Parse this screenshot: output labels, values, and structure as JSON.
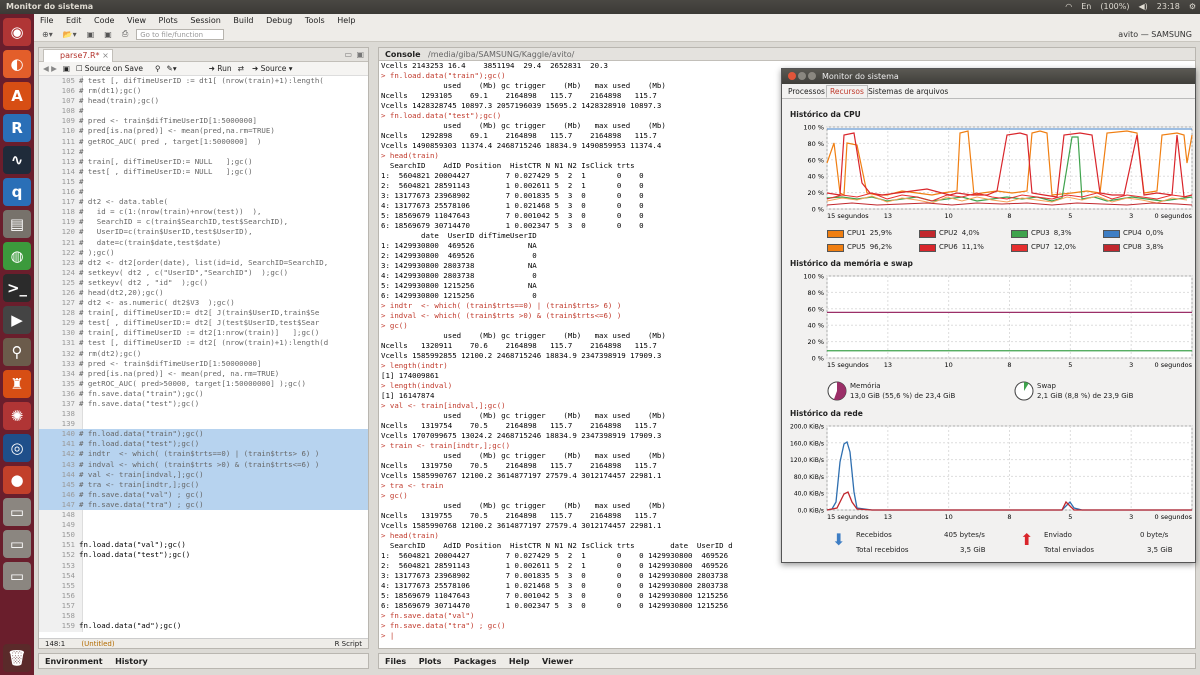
{
  "topbar": {
    "title": "Monitor do sistema",
    "lang": "En",
    "battery": "(100%)",
    "volume": "◀)",
    "time": "23:18"
  },
  "menu": [
    "File",
    "Edit",
    "Code",
    "View",
    "Plots",
    "Session",
    "Build",
    "Debug",
    "Tools",
    "Help"
  ],
  "toolbar": {
    "goto_placeholder": "Go to file/function",
    "project": "avito — SAMSUNG"
  },
  "editor": {
    "tab": "parse7.R*",
    "source_on_save": "Source on Save",
    "run": "Run",
    "source": "Source",
    "status_pos": "148:1",
    "status_scope": "(Untitled)",
    "status_type": "R Script"
  },
  "code_lines": [
    {
      "n": "105",
      "t": "# test [, difTimeUserID := dt1[ (nrow(train)+1):length(",
      "s": false,
      "c": false
    },
    {
      "n": "106",
      "t": "# rm(dt1);gc()",
      "s": false,
      "c": false
    },
    {
      "n": "107",
      "t": "# head(train);gc()",
      "s": false,
      "c": false
    },
    {
      "n": "108",
      "t": "#",
      "s": false,
      "c": false
    },
    {
      "n": "109",
      "t": "# pred <- train$difTimeUserID[1:5000000]",
      "s": false,
      "c": false
    },
    {
      "n": "110",
      "t": "# pred[is.na(pred)] <- mean(pred,na.rm=TRUE)",
      "s": false,
      "c": false
    },
    {
      "n": "111",
      "t": "# getROC_AUC( pred , target[1:5000000]  )",
      "s": false,
      "c": false
    },
    {
      "n": "112",
      "t": "#",
      "s": false,
      "c": false
    },
    {
      "n": "113",
      "t": "# train[, difTimeUserID:= NULL   ];gc()",
      "s": false,
      "c": false
    },
    {
      "n": "114",
      "t": "# test[ , difTimeUserID:= NULL   ];gc()",
      "s": false,
      "c": false
    },
    {
      "n": "115",
      "t": "#",
      "s": false,
      "c": false
    },
    {
      "n": "116",
      "t": "#",
      "s": false,
      "c": false
    },
    {
      "n": "117",
      "t": "# dt2 <- data.table(",
      "s": false,
      "c": false
    },
    {
      "n": "118",
      "t": "#   id = c(1:(nrow(train)+nrow(test))  ),",
      "s": false,
      "c": false
    },
    {
      "n": "119",
      "t": "#   SearchID = c(train$SearchID,test$SearchID),",
      "s": false,
      "c": false
    },
    {
      "n": "120",
      "t": "#   UserID=c(train$UserID,test$UserID),",
      "s": false,
      "c": false
    },
    {
      "n": "121",
      "t": "#   date=c(train$date,test$date)",
      "s": false,
      "c": false
    },
    {
      "n": "122",
      "t": "# );gc()",
      "s": false,
      "c": false
    },
    {
      "n": "123",
      "t": "# dt2 <- dt2[order(date), list(id=id, SearchID=SearchID,",
      "s": false,
      "c": false
    },
    {
      "n": "124",
      "t": "# setkeyv( dt2 , c(\"UserID\",\"SearchID\")  );gc()",
      "s": false,
      "c": false
    },
    {
      "n": "125",
      "t": "# setkeyv( dt2 , \"id\"  );gc()",
      "s": false,
      "c": false
    },
    {
      "n": "126",
      "t": "# head(dt2,20);gc()",
      "s": false,
      "c": false
    },
    {
      "n": "127",
      "t": "# dt2 <- as.numeric( dt2$V3  );gc()",
      "s": false,
      "c": false
    },
    {
      "n": "128",
      "t": "# train[, difTimeUserID:= dt2[ J(train$UserID,train$Se",
      "s": false,
      "c": false
    },
    {
      "n": "129",
      "t": "# test[ , difTimeUserID:= dt2[ J(test$UserID,test$Sear",
      "s": false,
      "c": false
    },
    {
      "n": "130",
      "t": "# train[, difTimeUserID := dt2[1:nrow(train)]   ];gc()",
      "s": false,
      "c": false
    },
    {
      "n": "131",
      "t": "# test [, difTimeUserID := dt2[ (nrow(train)+1):length(d",
      "s": false,
      "c": false
    },
    {
      "n": "132",
      "t": "# rm(dt2);gc()",
      "s": false,
      "c": false
    },
    {
      "n": "133",
      "t": "# pred <- train$difTimeUserID[1:50000000]",
      "s": false,
      "c": false
    },
    {
      "n": "134",
      "t": "# pred[is.na(pred)] <- mean(pred, na.rm=TRUE)",
      "s": false,
      "c": false
    },
    {
      "n": "135",
      "t": "# getROC_AUC( pred>50000, target[1:50000000] );gc()",
      "s": false,
      "c": false
    },
    {
      "n": "136",
      "t": "# fn.save.data(\"train\");gc()",
      "s": false,
      "c": false
    },
    {
      "n": "137",
      "t": "# fn.save.data(\"test\");gc()",
      "s": false,
      "c": false
    },
    {
      "n": "138",
      "t": "",
      "s": false,
      "c": false
    },
    {
      "n": "139",
      "t": "",
      "s": false,
      "c": false
    },
    {
      "n": "140",
      "t": "# fn.load.data(\"train\");gc()",
      "s": true,
      "c": false
    },
    {
      "n": "141",
      "t": "# fn.load.data(\"test\");gc()",
      "s": true,
      "c": false
    },
    {
      "n": "142",
      "t": "# indtr  <- which( (train$trts==0) | (train$trts> 6) )",
      "s": true,
      "c": false
    },
    {
      "n": "143",
      "t": "# indval <- which( (train$trts >0) & (train$trts<=6) )",
      "s": true,
      "c": false
    },
    {
      "n": "144",
      "t": "# val <- train[indval,];gc()",
      "s": true,
      "c": false
    },
    {
      "n": "145",
      "t": "# tra <- train[indtr,];gc()",
      "s": true,
      "c": false
    },
    {
      "n": "146",
      "t": "# fn.save.data(\"val\") ; gc()",
      "s": true,
      "c": false
    },
    {
      "n": "147",
      "t": "# fn.save.data(\"tra\") ; gc()",
      "s": true,
      "c": false
    },
    {
      "n": "148",
      "t": "",
      "s": false,
      "c": false
    },
    {
      "n": "149",
      "t": "",
      "s": false,
      "c": false
    },
    {
      "n": "150",
      "t": "",
      "s": false,
      "c": false
    },
    {
      "n": "151",
      "t": "fn.load.data(\"val\");gc()",
      "s": false,
      "c": true
    },
    {
      "n": "152",
      "t": "fn.load.data(\"test\");gc()",
      "s": false,
      "c": true
    },
    {
      "n": "153",
      "t": "",
      "s": false,
      "c": false
    },
    {
      "n": "154",
      "t": "",
      "s": false,
      "c": false
    },
    {
      "n": "155",
      "t": "",
      "s": false,
      "c": false
    },
    {
      "n": "156",
      "t": "",
      "s": false,
      "c": false
    },
    {
      "n": "157",
      "t": "",
      "s": false,
      "c": false
    },
    {
      "n": "158",
      "t": "",
      "s": false,
      "c": false
    },
    {
      "n": "159",
      "t": "fn.load.data(\"ad\");gc()",
      "s": false,
      "c": true
    },
    {
      "n": "160",
      "t": "ad <- data.table(ad)",
      "s": false,
      "c": true
    }
  ],
  "console": {
    "title": "Console",
    "path": "/media/giba/SAMSUNG/Kaggle/avito/"
  },
  "console_lines": [
    {
      "t": "Vcells 2143253 16.4    3851194  29.4  2652831  20.3",
      "c": false
    },
    {
      "t": "> fn.load.data(\"train\");gc()",
      "c": true
    },
    {
      "t": "              used    (Mb) gc trigger    (Mb)   max used    (Mb)",
      "c": false
    },
    {
      "t": "Ncells   1293105    69.1    2164898   115.7    2164898   115.7",
      "c": false
    },
    {
      "t": "Vcells 1428328745 10897.3 2057196039 15695.2 1428328910 10897.3",
      "c": false
    },
    {
      "t": "> fn.load.data(\"test\");gc()",
      "c": true
    },
    {
      "t": "              used    (Mb) gc trigger    (Mb)   max used    (Mb)",
      "c": false
    },
    {
      "t": "Ncells   1292898    69.1    2164898   115.7    2164898   115.7",
      "c": false
    },
    {
      "t": "Vcells 1490859303 11374.4 2468715246 18834.9 1490859953 11374.4",
      "c": false
    },
    {
      "t": "> head(train)",
      "c": true
    },
    {
      "t": "  SearchID    AdID Position  HistCTR N N1 N2 IsClick trts",
      "c": false
    },
    {
      "t": "1:  5604821 20004427        7 0.027429 5  2  1       0    0",
      "c": false
    },
    {
      "t": "2:  5604821 28591143        1 0.002611 5  2  1       0    0",
      "c": false
    },
    {
      "t": "3: 13177673 23968902        7 0.001835 5  3  0       0    0",
      "c": false
    },
    {
      "t": "4: 13177673 25578106        1 0.021468 5  3  0       0    0",
      "c": false
    },
    {
      "t": "5: 18569679 11047643        7 0.001042 5  3  0       0    0",
      "c": false
    },
    {
      "t": "6: 18569679 30714470        1 0.002347 5  3  0       0    0",
      "c": false
    },
    {
      "t": "         date  UserID difTimeUserID",
      "c": false
    },
    {
      "t": "1: 1429930800  469526            NA",
      "c": false
    },
    {
      "t": "2: 1429930800  469526             0",
      "c": false
    },
    {
      "t": "3: 1429930800 2803738            NA",
      "c": false
    },
    {
      "t": "4: 1429930800 2803738             0",
      "c": false
    },
    {
      "t": "5: 1429930800 1215256            NA",
      "c": false
    },
    {
      "t": "6: 1429930800 1215256             0",
      "c": false
    },
    {
      "t": "> indtr  <- which( (train$trts==0) | (train$trts> 6) )",
      "c": true
    },
    {
      "t": "> indval <- which( (train$trts >0) & (train$trts<=6) )",
      "c": true
    },
    {
      "t": "> gc()",
      "c": true
    },
    {
      "t": "              used    (Mb) gc trigger    (Mb)   max used    (Mb)",
      "c": false
    },
    {
      "t": "Ncells   1320911    70.6    2164898   115.7    2164898   115.7",
      "c": false
    },
    {
      "t": "Vcells 1585992855 12100.2 2468715246 18834.9 2347398919 17909.3",
      "c": false
    },
    {
      "t": "> length(indtr)",
      "c": true
    },
    {
      "t": "[1] 174009861",
      "c": false
    },
    {
      "t": "> length(indval)",
      "c": true
    },
    {
      "t": "[1] 16147874",
      "c": false
    },
    {
      "t": "> val <- train[indval,];gc()",
      "c": true
    },
    {
      "t": "              used    (Mb) gc trigger    (Mb)   max used    (Mb)",
      "c": false
    },
    {
      "t": "Ncells   1319754    70.5    2164898   115.7    2164898   115.7",
      "c": false
    },
    {
      "t": "Vcells 1707099675 13024.2 2468715246 18834.9 2347398919 17909.3",
      "c": false
    },
    {
      "t": "> train <- train[indtr,];gc()",
      "c": true
    },
    {
      "t": "              used    (Mb) gc trigger    (Mb)   max used    (Mb)",
      "c": false
    },
    {
      "t": "Ncells   1319750    70.5    2164898   115.7    2164898   115.7",
      "c": false
    },
    {
      "t": "Vcells 1585990767 12100.2 3614877197 27579.4 3012174457 22981.1",
      "c": false
    },
    {
      "t": "> tra <- train",
      "c": true
    },
    {
      "t": "> gc()",
      "c": true
    },
    {
      "t": "              used    (Mb) gc trigger    (Mb)   max used    (Mb)",
      "c": false
    },
    {
      "t": "Ncells   1319755    70.5    2164898   115.7    2164898   115.7",
      "c": false
    },
    {
      "t": "Vcells 1585990768 12100.2 3614877197 27579.4 3012174457 22981.1",
      "c": false
    },
    {
      "t": "> head(train)",
      "c": true
    },
    {
      "t": "  SearchID    AdID Position  HistCTR N N1 N2 IsClick trts        date  UserID d",
      "c": false
    },
    {
      "t": "1:  5604821 20004427        7 0.027429 5  2  1       0    0 1429930800  469526",
      "c": false
    },
    {
      "t": "2:  5604821 28591143        1 0.002611 5  2  1       0    0 1429930800  469526",
      "c": false
    },
    {
      "t": "3: 13177673 23968902        7 0.001835 5  3  0       0    0 1429930800 2803738",
      "c": false
    },
    {
      "t": "4: 13177673 25578106        1 0.021468 5  3  0       0    0 1429930800 2803738",
      "c": false
    },
    {
      "t": "5: 18569679 11047643        7 0.001042 5  3  0       0    0 1429930800 1215256",
      "c": false
    },
    {
      "t": "6: 18569679 30714470        1 0.002347 5  3  0       0    0 1429930800 1215256",
      "c": false
    },
    {
      "t": "> fn.save.data(\"val\")",
      "c": true
    },
    {
      "t": "> fn.save.data(\"tra\") ; gc()",
      "c": true
    },
    {
      "t": "> |",
      "c": true
    }
  ],
  "bottom_left_tabs": [
    "Environment",
    "History"
  ],
  "bottom_right_tabs": [
    "Files",
    "Plots",
    "Packages",
    "Help",
    "Viewer"
  ],
  "monitor": {
    "title": "Monitor do sistema",
    "tabs": [
      "Processos",
      "Recursos",
      "Sistemas de arquivos"
    ],
    "cpu_title": "Histórico da CPU",
    "mem_title": "Histórico da memória e swap",
    "net_title": "Histórico da rede",
    "cpu_y": [
      "100 %",
      "80 %",
      "60 %",
      "40 %",
      "20 %",
      "0 %"
    ],
    "mem_y": [
      "100 %",
      "80 %",
      "60 %",
      "40 %",
      "20 %",
      "0 %"
    ],
    "net_y": [
      "200,0 KiB/s",
      "160,0 KiB/s",
      "120,0 KiB/s",
      "80,0 KiB/s",
      "40,0 KiB/s",
      "0,0 KiB/s"
    ],
    "x_ticks": [
      "15 segundos",
      "13",
      "10",
      "8",
      "5",
      "3",
      "0 segundos"
    ],
    "cpus": [
      {
        "name": "CPU1",
        "val": "25,9%",
        "color": "#f07f12"
      },
      {
        "name": "CPU2",
        "val": "4,0%",
        "color": "#c1272d"
      },
      {
        "name": "CPU3",
        "val": "8,3%",
        "color": "#3fa34d"
      },
      {
        "name": "CPU4",
        "val": "0,0%",
        "color": "#3e7ec4"
      },
      {
        "name": "CPU5",
        "val": "96,2%",
        "color": "#f07f12"
      },
      {
        "name": "CPU6",
        "val": "11,1%",
        "color": "#d9252b"
      },
      {
        "name": "CPU7",
        "val": "12,0%",
        "color": "#e62e2e"
      },
      {
        "name": "CPU8",
        "val": "3,8%",
        "color": "#c1272d"
      }
    ],
    "memory_label": "Memória",
    "memory_val": "13,0 GiB (55,6 %) de 23,4 GiB",
    "swap_label": "Swap",
    "swap_val": "2,1 GiB (8,8 %) de 23,9 GiB",
    "recv_label": "Recebidos",
    "recv_val": "405 bytes/s",
    "recv_total_label": "Total recebidos",
    "recv_total_val": "3,5 GiB",
    "sent_label": "Enviado",
    "sent_val": "0 byte/s",
    "sent_total_label": "Total enviados",
    "sent_total_val": "3,5 GiB",
    "mem_color": "#9b2f68",
    "swap_color": "#3fa34d"
  }
}
